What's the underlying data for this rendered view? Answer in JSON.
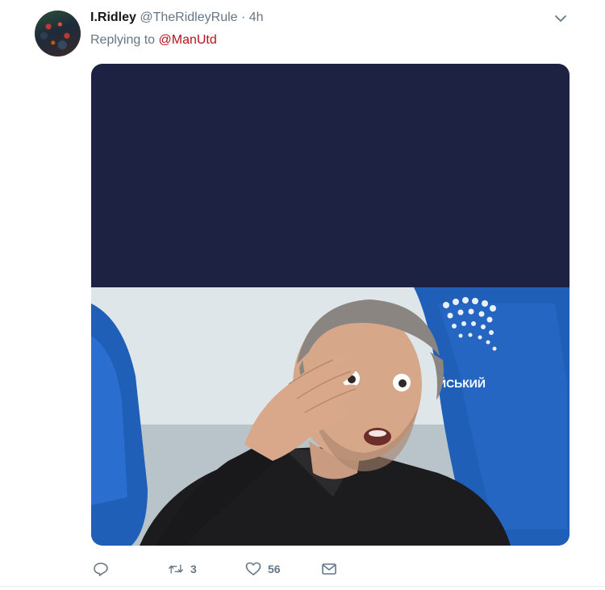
{
  "tweet": {
    "display_name": "I.Ridley",
    "handle": "@TheRidleyRule",
    "separator": "·",
    "time": "4h",
    "replying_to_label": "Replying to",
    "replying_to_handle": "@ManUtd",
    "stadium_text": "ЙСЬКИЙ"
  },
  "actions": {
    "reply_icon": "reply-icon",
    "retweet_icon": "retweet-icon",
    "retweet_count": "3",
    "like_icon": "heart-icon",
    "like_count": "56",
    "dm_icon": "envelope-icon"
  },
  "colors": {
    "mention": "#b5121b",
    "muted": "#657786",
    "media_bg": "#1d2242",
    "seat_blue": "#1f5fb8"
  }
}
